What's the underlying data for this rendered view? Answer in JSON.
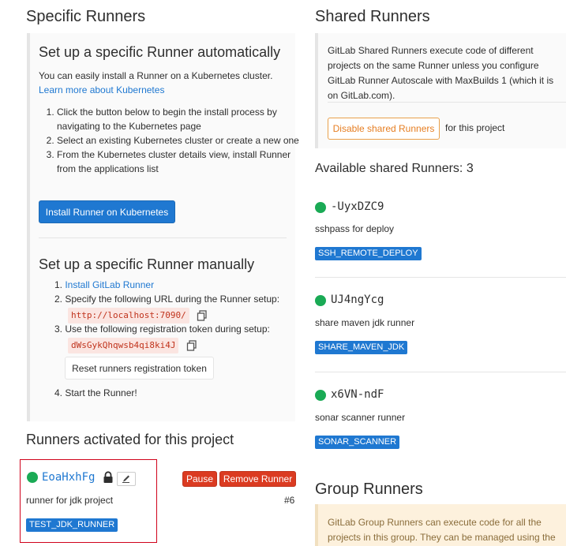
{
  "specific": {
    "title": "Specific Runners",
    "auto": {
      "heading": "Set up a specific Runner automatically",
      "description": "You can easily install a Runner on a Kubernetes cluster.",
      "learn_more": "Learn more about Kubernetes",
      "steps": [
        "Click the button below to begin the install process by navigating to the Kubernetes page",
        "Select an existing Kubernetes cluster or create a new one",
        "From the Kubernetes cluster details view, install Runner from the applications list"
      ],
      "install_button": "Install Runner on Kubernetes"
    },
    "manual": {
      "heading": "Set up a specific Runner manually",
      "step1_link": "Install GitLab Runner",
      "step2_text": "Specify the following URL during the Runner setup:",
      "url": "http://localhost:7090/",
      "step3_text": "Use the following registration token during setup:",
      "token": "dWsGykQhqwsb4qi8ki4J",
      "reset_button": "Reset runners registration token",
      "step4_text": "Start the Runner!"
    },
    "activated": {
      "title": "Runners activated for this project",
      "runner": {
        "name": "EoaHxhFg",
        "description": "runner for jdk project",
        "tag": "TEST_JDK_RUNNER",
        "id": "#6",
        "pause_label": "Pause",
        "remove_label": "Remove Runner"
      }
    }
  },
  "shared": {
    "title": "Shared Runners",
    "info": "GitLab Shared Runners execute code of different projects on the same Runner unless you configure GitLab Runner Autoscale with MaxBuilds 1 (which it is on GitLab.com).",
    "disable_button": "Disable shared Runners",
    "disable_suffix": "for this project",
    "available_title": "Available shared Runners: 3",
    "runners": [
      {
        "name": "-UyxDZC9",
        "description": "sshpass for deploy",
        "tag": "SSH_REMOTE_DEPLOY"
      },
      {
        "name": "UJ4ngYcg",
        "description": "share maven jdk runner",
        "tag": "SHARE_MAVEN_JDK"
      },
      {
        "name": "x6VN-ndF",
        "description": "sonar scanner runner",
        "tag": "SONAR_SCANNER"
      }
    ]
  },
  "group": {
    "title": "Group Runners",
    "info": "GitLab Group Runners can execute code for all the projects in this group. They can be managed using the Runners"
  },
  "colors": {
    "primary": "#1f78d1",
    "online": "#1aaa55",
    "danger": "#db3b21",
    "warning": "#e67e22",
    "highlight": "#d0021b"
  }
}
